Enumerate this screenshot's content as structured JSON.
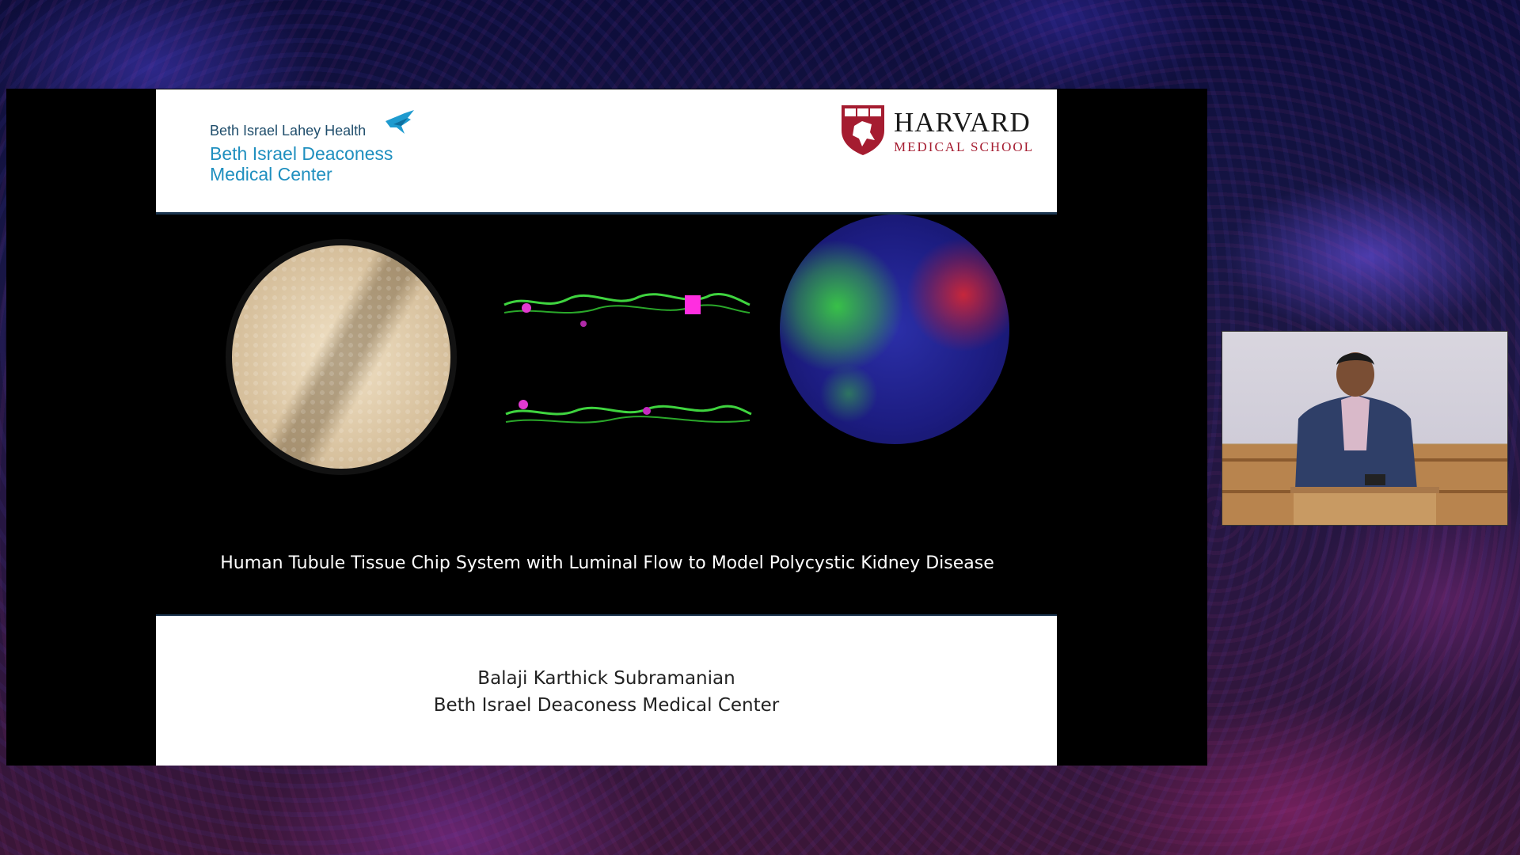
{
  "header": {
    "bilh_brand": "Beth Israel Lahey Health",
    "bidmc_name": "Beth Israel Deaconess\nMedical Center",
    "harvard_word": "HARVARD",
    "harvard_school": "MEDICAL SCHOOL"
  },
  "slide": {
    "title": "Human Tubule Tissue Chip System with Luminal Flow to Model Polycystic Kidney Disease",
    "presenter_name": "Balaji Karthick Subramanian",
    "presenter_affiliation": "Beth Israel Deaconess Medical Center"
  },
  "colors": {
    "bilh_teal": "#1f8fbf",
    "harvard_crimson": "#a51c30",
    "slide_divider": "#1b3550"
  },
  "icons": [
    "bilh-bird-logo-icon",
    "harvard-veritas-shield-icon"
  ]
}
